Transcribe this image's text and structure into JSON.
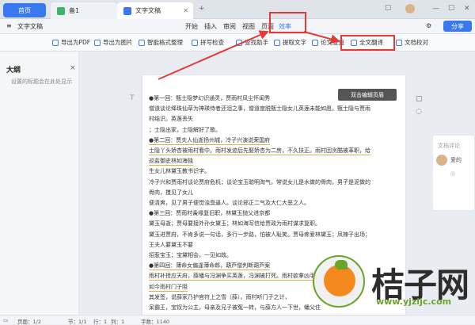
{
  "tabs": {
    "home": "首页",
    "doc1": "备1",
    "doc2": "文字文稿"
  },
  "top_icons": [
    "☐",
    "⌂",
    "▭",
    "—",
    "☐",
    "✕"
  ],
  "menubar": {
    "file": "文字文稿",
    "items": [
      "开始",
      "插入",
      "审阅",
      "视图",
      "页面",
      "效率"
    ],
    "share": "分享"
  },
  "toolbar": [
    "导出为PDF",
    "导出为图片",
    "智能格式整理",
    "拼写检查",
    "查找助手",
    "提取文字",
    "论文查重",
    "全文翻译",
    "文档校对"
  ],
  "sidebar": {
    "title": "大纲",
    "placeholder": "设置的标题会在此处显示",
    "close": "×"
  },
  "tooltip": "双击编辑页眉",
  "document_lines": [
    "●第一回：甄士隐梦幻识通灵，贾雨村风尘怀闺秀",
    "僧道谈论绛珠仙草为神瑛侍者还泪之事，僧道度脱甄士隐女儿英莲未能如愿。甄士隐与贾雨",
    "村结识。英莲丢失",
    "；士隐出家，士隐解好了歌。",
    "●第二回：贾夫人仙逝扬州城，冷子兴演说荣国府",
    "士隐丫头娇杏被雨村看中。雨村发迹后先娶娇杏为二房，不久扶正。雨村因贪酷被革职，给",
    "巡盐御史林如海独",
    "生女儿林黛玉教书识字。",
    "冷子兴和贾雨村谈论贾府危机；谈论宝玉聪明淘气，常说女儿是水做的骨肉，男子是泥做的",
    "骨肉，搅见了女儿",
    "便清爽，见了男子便觉浊臭逼人。谈论邪正二气及大仁大恶之人。",
    "●第三回：贾雨村夤缘复旧职，林黛玉抛父进京都",
    "黛玉母逝；贾母要接外孙女黛玉；林如海写信给贾政为雨村谋求复职。",
    "黛玉进贾府，不肯多说一句话，多行一步路，怕被人耻笑。贾母疼爱林黛玉；凤辣子出场；",
    "王夫人要黛玉不要",
    "招惹宝玉；宝黛相会，一见如故。",
    "●第四回：薄命女偏逢薄命郎，葫芦僧判断葫芦案",
    "雨村补授应天府，薛蟠与冯渊争买英莲，冯渊被打死。雨村欲拿凶手，",
    "如今雨村门子阻",
    "其发签，说薛家乃护官符上之雪（薛）。雨村听门子之计，",
    "呆霸王，宝钗为公主，母亲及兄子被冤一转，与薛方人一下世，蟠父住"
  ],
  "right_card": {
    "header": "文档评论",
    "user": "爱的",
    "note": "◎"
  },
  "statusbar": {
    "page": "页面：1/2",
    "section": "节：1/1",
    "row": "行：1",
    "col": "列：1",
    "words": "字数：1140"
  },
  "watermark": {
    "brand": "桔子网",
    "url": "www.yjzljc.com"
  },
  "colors": {
    "accent": "#3a78f2",
    "annotation": "#e53935",
    "underline": "#e0b050"
  }
}
